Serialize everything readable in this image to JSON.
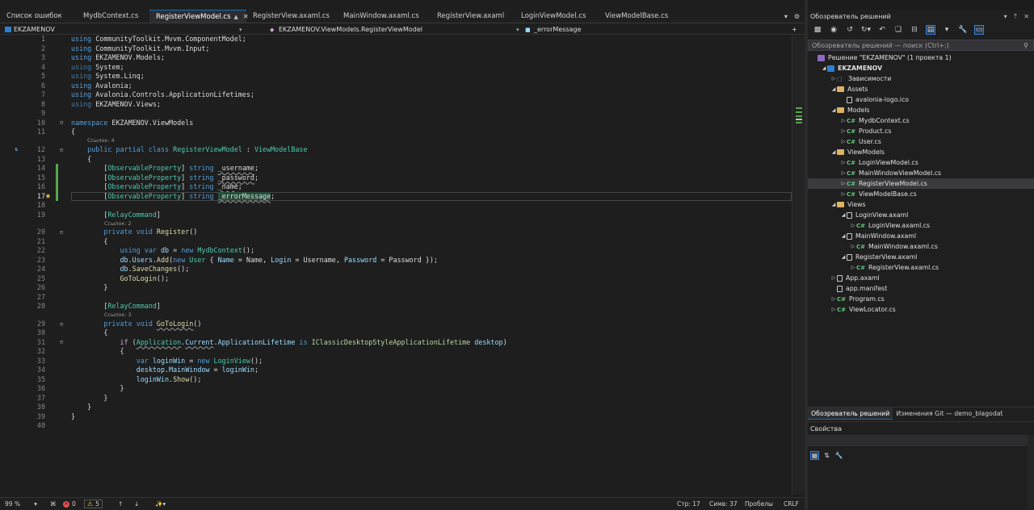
{
  "doc_tabs": [
    {
      "label": "Список ошибок",
      "active": false
    },
    {
      "label": "MydbContext.cs",
      "active": false
    },
    {
      "label": "RegisterViewModel.cs",
      "active": true
    },
    {
      "label": "RegisterView.axaml.cs",
      "active": false
    },
    {
      "label": "MainWindow.axaml.cs",
      "active": false
    },
    {
      "label": "RegisterView.axaml",
      "active": false
    },
    {
      "label": "LoginViewModel.cs",
      "active": false
    },
    {
      "label": "ViewModelBase.cs",
      "active": false
    }
  ],
  "nav_bar": {
    "project": "EKZAMENOV",
    "type": "EKZAMENOV.ViewModels.RegisterViewModel",
    "member": "_errorMessage"
  },
  "code": {
    "lens_refs4": "Ссылок: 4",
    "lens_refs2": "Ссылок: 2",
    "lens_refs3": "Ссылок: 3"
  },
  "status_bar": {
    "zoom": "99 %",
    "errors": "0",
    "warnings": "5",
    "line": "Стр: 17",
    "col": "Симв: 37",
    "whitespace": "Пробелы",
    "eol": "CRLF"
  },
  "solution_explorer": {
    "title": "Обозреватель решений",
    "search_placeholder": "Обозреватель решений — поиск (Ctrl+;)",
    "tree": [
      {
        "label": "Решение \"EKZAMENOV\" (1 проекта 1)",
        "icon": "solution",
        "indent": 0,
        "arrow": "",
        "selected": false
      },
      {
        "label": "EKZAMENOV",
        "icon": "project",
        "indent": 1,
        "arrow": "open",
        "selected": false,
        "bold": true
      },
      {
        "label": "Зависимости",
        "icon": "deps",
        "indent": 2,
        "arrow": "closed",
        "selected": false
      },
      {
        "label": "Assets",
        "icon": "folder",
        "indent": 2,
        "arrow": "open",
        "selected": false
      },
      {
        "label": "avalonia-logo.ico",
        "icon": "file",
        "indent": 3,
        "arrow": "",
        "selected": false
      },
      {
        "label": "Models",
        "icon": "folder",
        "indent": 2,
        "arrow": "open",
        "selected": false
      },
      {
        "label": "MydbContext.cs",
        "icon": "cs",
        "indent": 3,
        "arrow": "closed",
        "selected": false
      },
      {
        "label": "Product.cs",
        "icon": "cs",
        "indent": 3,
        "arrow": "closed",
        "selected": false
      },
      {
        "label": "User.cs",
        "icon": "cs",
        "indent": 3,
        "arrow": "closed",
        "selected": false
      },
      {
        "label": "ViewModels",
        "icon": "folder",
        "indent": 2,
        "arrow": "open",
        "selected": false
      },
      {
        "label": "LoginViewModel.cs",
        "icon": "cs",
        "indent": 3,
        "arrow": "closed",
        "selected": false
      },
      {
        "label": "MainWindowViewModel.cs",
        "icon": "cs",
        "indent": 3,
        "arrow": "closed",
        "selected": false
      },
      {
        "label": "RegisterViewModel.cs",
        "icon": "cs",
        "indent": 3,
        "arrow": "closed",
        "selected": true
      },
      {
        "label": "ViewModelBase.cs",
        "icon": "cs",
        "indent": 3,
        "arrow": "closed",
        "selected": false
      },
      {
        "label": "Views",
        "icon": "folder",
        "indent": 2,
        "arrow": "open",
        "selected": false
      },
      {
        "label": "LoginView.axaml",
        "icon": "file",
        "indent": 3,
        "arrow": "open",
        "selected": false
      },
      {
        "label": "LoginView.axaml.cs",
        "icon": "cs",
        "indent": 4,
        "arrow": "closed",
        "selected": false
      },
      {
        "label": "MainWindow.axaml",
        "icon": "file",
        "indent": 3,
        "arrow": "open",
        "selected": false
      },
      {
        "label": "MainWindow.axaml.cs",
        "icon": "cs",
        "indent": 4,
        "arrow": "closed",
        "selected": false
      },
      {
        "label": "RegisterView.axaml",
        "icon": "file",
        "indent": 3,
        "arrow": "open",
        "selected": false
      },
      {
        "label": "RegisterView.axaml.cs",
        "icon": "cs",
        "indent": 4,
        "arrow": "closed",
        "selected": false
      },
      {
        "label": "App.axaml",
        "icon": "file",
        "indent": 2,
        "arrow": "closed",
        "selected": false
      },
      {
        "label": "app.manifest",
        "icon": "file",
        "indent": 2,
        "arrow": "",
        "selected": false
      },
      {
        "label": "Program.cs",
        "icon": "cs",
        "indent": 2,
        "arrow": "closed",
        "selected": false
      },
      {
        "label": "ViewLocator.cs",
        "icon": "cs",
        "indent": 2,
        "arrow": "closed",
        "selected": false
      }
    ]
  },
  "panel_tabs": [
    {
      "label": "Обозреватель решений",
      "active": true
    },
    {
      "label": "Изменения Git — demo_blagodat",
      "active": false
    }
  ],
  "properties": {
    "title": "Свойства"
  },
  "icons": {
    "close": "close-icon",
    "pin": "pin-icon",
    "chevron": "chevron-down-icon",
    "lightbulb": "lightbulb-icon",
    "error": "error-icon",
    "warning": "warning-icon",
    "up": "arrow-up-icon",
    "down": "arrow-down-icon"
  },
  "colors": {
    "keyword": "#569cd6",
    "type": "#4ec9b0",
    "method": "#dcdcaa",
    "variable": "#9cdcfe",
    "accent": "#0e70c0",
    "change_bar": "#56a64b"
  }
}
